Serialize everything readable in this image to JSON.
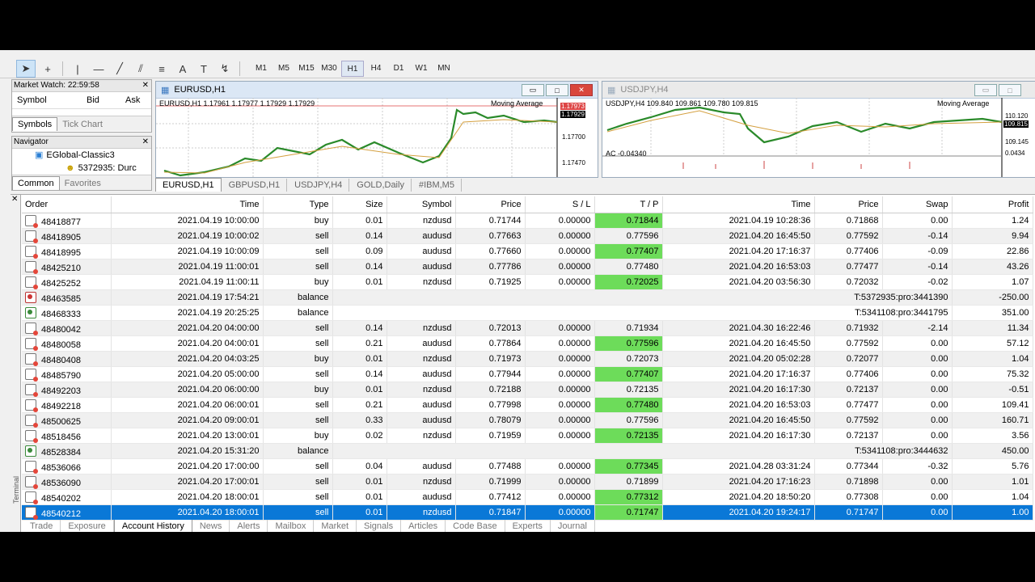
{
  "timeframes": [
    "M1",
    "M5",
    "M15",
    "M30",
    "H1",
    "H4",
    "D1",
    "W1",
    "MN"
  ],
  "active_timeframe": "H1",
  "market_watch": {
    "title": "Market Watch: 22:59:58",
    "columns": [
      "Symbol",
      "Bid",
      "Ask"
    ],
    "tabs": [
      "Symbols",
      "Tick Chart"
    ]
  },
  "navigator": {
    "title": "Navigator",
    "items": [
      "EGlobal-Classic3",
      "5372935: Durc"
    ],
    "tabs": [
      "Common",
      "Favorites"
    ]
  },
  "charts": [
    {
      "title": "EURUSD,H1",
      "info": "EURUSD,H1  1.17961 1.17977 1.17929 1.17929",
      "indicator": "Moving Average",
      "prices": [
        "1.17973",
        "1.17929",
        "1.17700",
        "1.17470"
      ]
    },
    {
      "title": "USDJPY,H4",
      "info": "USDJPY,H4  109.840 109.861 109.780 109.815",
      "indicator": "Moving Average",
      "prices": [
        "110.120",
        "109.815",
        "109.145",
        "0.0434"
      ],
      "sub": "AC -0.04340"
    }
  ],
  "chart_tabs": [
    "EURUSD,H1",
    "GBPUSD,H1",
    "USDJPY,H4",
    "GOLD,Daily",
    "#IBM,M5"
  ],
  "columns": [
    "Order",
    "Time",
    "Type",
    "Size",
    "Symbol",
    "Price",
    "S / L",
    "T / P",
    "Time",
    "Price",
    "Swap",
    "Profit"
  ],
  "rows": [
    {
      "order": "48418877",
      "time": "2021.04.19 10:00:00",
      "type": "buy",
      "size": "0.01",
      "symbol": "nzdusd",
      "price": "0.71744",
      "sl": "0.00000",
      "tp": "0.71844",
      "ctime": "2021.04.19 10:28:36",
      "cprice": "0.71868",
      "swap": "0.00",
      "profit": "1.24"
    },
    {
      "order": "48418905",
      "time": "2021.04.19 10:00:02",
      "type": "sell",
      "size": "0.14",
      "symbol": "audusd",
      "price": "0.77663",
      "sl": "0.00000",
      "tp": "0.77596",
      "ctime": "2021.04.20 16:45:50",
      "cprice": "0.77592",
      "swap": "-0.14",
      "profit": "9.94"
    },
    {
      "order": "48418995",
      "time": "2021.04.19 10:00:09",
      "type": "sell",
      "size": "0.09",
      "symbol": "audusd",
      "price": "0.77660",
      "sl": "0.00000",
      "tp": "0.77407",
      "ctime": "2021.04.20 17:16:37",
      "cprice": "0.77406",
      "swap": "-0.09",
      "profit": "22.86"
    },
    {
      "order": "48425210",
      "time": "2021.04.19 11:00:01",
      "type": "sell",
      "size": "0.14",
      "symbol": "audusd",
      "price": "0.77786",
      "sl": "0.00000",
      "tp": "0.77480",
      "ctime": "2021.04.20 16:53:03",
      "cprice": "0.77477",
      "swap": "-0.14",
      "profit": "43.26"
    },
    {
      "order": "48425252",
      "time": "2021.04.19 11:00:11",
      "type": "buy",
      "size": "0.01",
      "symbol": "nzdusd",
      "price": "0.71925",
      "sl": "0.00000",
      "tp": "0.72025",
      "ctime": "2021.04.20 03:56:30",
      "cprice": "0.72032",
      "swap": "-0.02",
      "profit": "1.07"
    },
    {
      "order": "48463585",
      "time": "2021.04.19 17:54:21",
      "type": "balance",
      "comment": "T:5372935:pro:3441390",
      "profit": "-250.00",
      "kind": "neg"
    },
    {
      "order": "48468333",
      "time": "2021.04.19 20:25:25",
      "type": "balance",
      "comment": "T:5341108:pro:3441795",
      "profit": "351.00",
      "kind": "bal"
    },
    {
      "order": "48480042",
      "time": "2021.04.20 04:00:00",
      "type": "sell",
      "size": "0.14",
      "symbol": "nzdusd",
      "price": "0.72013",
      "sl": "0.00000",
      "tp": "0.71934",
      "ctime": "2021.04.30 16:22:46",
      "cprice": "0.71932",
      "swap": "-2.14",
      "profit": "11.34"
    },
    {
      "order": "48480058",
      "time": "2021.04.20 04:00:01",
      "type": "sell",
      "size": "0.21",
      "symbol": "audusd",
      "price": "0.77864",
      "sl": "0.00000",
      "tp": "0.77596",
      "ctime": "2021.04.20 16:45:50",
      "cprice": "0.77592",
      "swap": "0.00",
      "profit": "57.12"
    },
    {
      "order": "48480408",
      "time": "2021.04.20 04:03:25",
      "type": "buy",
      "size": "0.01",
      "symbol": "nzdusd",
      "price": "0.71973",
      "sl": "0.00000",
      "tp": "0.72073",
      "ctime": "2021.04.20 05:02:28",
      "cprice": "0.72077",
      "swap": "0.00",
      "profit": "1.04"
    },
    {
      "order": "48485790",
      "time": "2021.04.20 05:00:00",
      "type": "sell",
      "size": "0.14",
      "symbol": "audusd",
      "price": "0.77944",
      "sl": "0.00000",
      "tp": "0.77407",
      "ctime": "2021.04.20 17:16:37",
      "cprice": "0.77406",
      "swap": "0.00",
      "profit": "75.32"
    },
    {
      "order": "48492203",
      "time": "2021.04.20 06:00:00",
      "type": "buy",
      "size": "0.01",
      "symbol": "nzdusd",
      "price": "0.72188",
      "sl": "0.00000",
      "tp": "0.72135",
      "ctime": "2021.04.20 16:17:30",
      "cprice": "0.72137",
      "swap": "0.00",
      "profit": "-0.51"
    },
    {
      "order": "48492218",
      "time": "2021.04.20 06:00:01",
      "type": "sell",
      "size": "0.21",
      "symbol": "audusd",
      "price": "0.77998",
      "sl": "0.00000",
      "tp": "0.77480",
      "ctime": "2021.04.20 16:53:03",
      "cprice": "0.77477",
      "swap": "0.00",
      "profit": "109.41"
    },
    {
      "order": "48500625",
      "time": "2021.04.20 09:00:01",
      "type": "sell",
      "size": "0.33",
      "symbol": "audusd",
      "price": "0.78079",
      "sl": "0.00000",
      "tp": "0.77596",
      "ctime": "2021.04.20 16:45:50",
      "cprice": "0.77592",
      "swap": "0.00",
      "profit": "160.71"
    },
    {
      "order": "48518456",
      "time": "2021.04.20 13:00:01",
      "type": "buy",
      "size": "0.02",
      "symbol": "nzdusd",
      "price": "0.71959",
      "sl": "0.00000",
      "tp": "0.72135",
      "ctime": "2021.04.20 16:17:30",
      "cprice": "0.72137",
      "swap": "0.00",
      "profit": "3.56"
    },
    {
      "order": "48528384",
      "time": "2021.04.20 15:31:20",
      "type": "balance",
      "comment": "T:5341108:pro:3444632",
      "profit": "450.00",
      "kind": "bal"
    },
    {
      "order": "48536066",
      "time": "2021.04.20 17:00:00",
      "type": "sell",
      "size": "0.04",
      "symbol": "audusd",
      "price": "0.77488",
      "sl": "0.00000",
      "tp": "0.77345",
      "ctime": "2021.04.28 03:31:24",
      "cprice": "0.77344",
      "swap": "-0.32",
      "profit": "5.76"
    },
    {
      "order": "48536090",
      "time": "2021.04.20 17:00:01",
      "type": "sell",
      "size": "0.01",
      "symbol": "nzdusd",
      "price": "0.71999",
      "sl": "0.00000",
      "tp": "0.71899",
      "ctime": "2021.04.20 17:16:23",
      "cprice": "0.71898",
      "swap": "0.00",
      "profit": "1.01"
    },
    {
      "order": "48540202",
      "time": "2021.04.20 18:00:01",
      "type": "sell",
      "size": "0.01",
      "symbol": "audusd",
      "price": "0.77412",
      "sl": "0.00000",
      "tp": "0.77312",
      "ctime": "2021.04.20 18:50:20",
      "cprice": "0.77308",
      "swap": "0.00",
      "profit": "1.04"
    },
    {
      "order": "48540212",
      "time": "2021.04.20 18:00:01",
      "type": "sell",
      "size": "0.01",
      "symbol": "nzdusd",
      "price": "0.71847",
      "sl": "0.00000",
      "tp": "0.71747",
      "ctime": "2021.04.20 19:24:17",
      "cprice": "0.71747",
      "swap": "0.00",
      "profit": "1.00",
      "selected": true
    }
  ],
  "bottom_tabs": [
    "Trade",
    "Exposure",
    "Account History",
    "News",
    "Alerts",
    "Mailbox",
    "Market",
    "Signals",
    "Articles",
    "Code Base",
    "Experts",
    "Journal"
  ],
  "active_bottom_tab": "Account History",
  "terminal_label": "Terminal"
}
